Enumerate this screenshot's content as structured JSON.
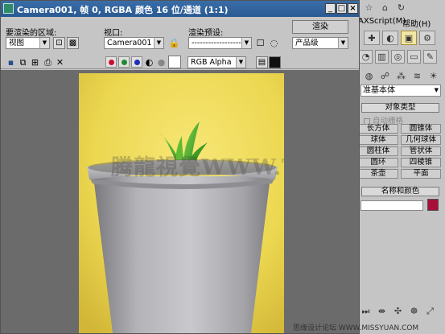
{
  "window": {
    "title": "Camera001, 帧 0, RGBA 颜色 16 位/通道 (1:1)",
    "buttons": {
      "minimize": "_",
      "maximize": "□",
      "close": "×"
    }
  },
  "toolbar": {
    "area_label": "要渲染的区域:",
    "area_value": "视图",
    "viewport_label": "视口:",
    "viewport_value": "Camera001",
    "preset_label": "渲染预设:",
    "preset_value": "--------------------",
    "render_button": "渲染",
    "product_value": "产品级",
    "channel_value": "RGB Alpha",
    "channel_colors": {
      "red": "#c8102e",
      "green": "#1f8a2f",
      "blue": "#1c2fb8"
    }
  },
  "command_panel": {
    "menu_script": "AXScript(M)",
    "menu_help": "帮助(H)",
    "category_value": "准基本体",
    "object_type_header": "对象类型",
    "autogrid_label": "自动栅格",
    "primitives": [
      "长方体",
      "圆锥体",
      "球体",
      "几何球体",
      "圆柱体",
      "管状体",
      "圆环",
      "四棱锥",
      "茶壶",
      "平面"
    ],
    "name_color_header": "名称和颜色",
    "object_color": "#a8103a"
  },
  "watermark": {
    "text": "腾龍視覺WWW.TLVI.NET",
    "bottom_text": "思缘设计论坛 WWW.MISSYUAN.COM"
  }
}
